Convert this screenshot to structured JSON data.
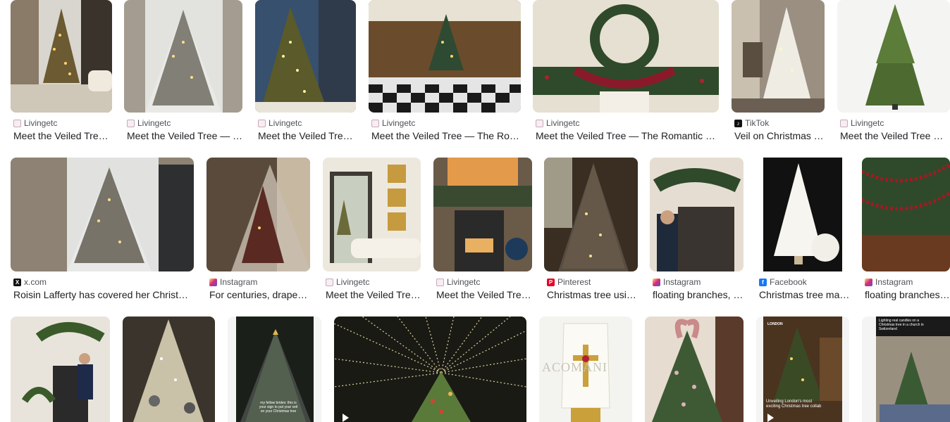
{
  "results": [
    {
      "source": "Livingetc",
      "title": "Meet the Veiled Tree — The Romantic Christmas Trend"
    },
    {
      "source": "Livingetc",
      "title": "Meet the Veiled Tree — The Romantic Christmas Trend"
    },
    {
      "source": "Livingetc",
      "title": "Meet the Veiled Tree — The Romantic Christmas Trend"
    },
    {
      "source": "Livingetc",
      "title": "Meet the Veiled Tree — The Romantic Christmas Trend"
    },
    {
      "source": "Livingetc",
      "title": "Meet the Veiled Tree — The Romantic Christmas Trend"
    },
    {
      "source": "TikTok",
      "title": "Veil on Christmas Tree"
    },
    {
      "source": "Livingetc",
      "title": "Meet the Veiled Tree — The Romantic Christmas Trend"
    },
    {
      "source": "x.com",
      "title": "Roisin Lafferty has covered her Christmas tree"
    },
    {
      "source": "Instagram",
      "title": "For centuries, drapery has been used"
    },
    {
      "source": "Livingetc",
      "title": "Meet the Veiled Tree — The Romantic Christmas Trend"
    },
    {
      "source": "Livingetc",
      "title": "Meet the Veiled Tree — The Romantic Christmas Trend"
    },
    {
      "source": "Pinterest",
      "title": "Christmas tree using a veil"
    },
    {
      "source": "Instagram",
      "title": "floating branches, garlands and veils"
    },
    {
      "source": "Facebook",
      "title": "Christmas tree made of tulle"
    },
    {
      "source": "Instagram",
      "title": "floating branches, garlands and veils"
    }
  ],
  "overlay_texts": {
    "veil_caption": "my fellow brides: this is your sign to put your veil on your Christmas tree",
    "london_caption": "Unveiling London's most exciting Christmas tree collab",
    "london_tag": "LONDON",
    "church_caption": "Lighting real candles on a Christmas tree in a church in Switzerland",
    "watermark": "ACOMANI"
  },
  "icons": {
    "Livingetc": "livingetc-favicon-icon",
    "x.com": "x-logo-icon",
    "TikTok": "tiktok-logo-icon",
    "Instagram": "instagram-logo-icon",
    "Pinterest": "pinterest-logo-icon",
    "Facebook": "facebook-logo-icon"
  }
}
